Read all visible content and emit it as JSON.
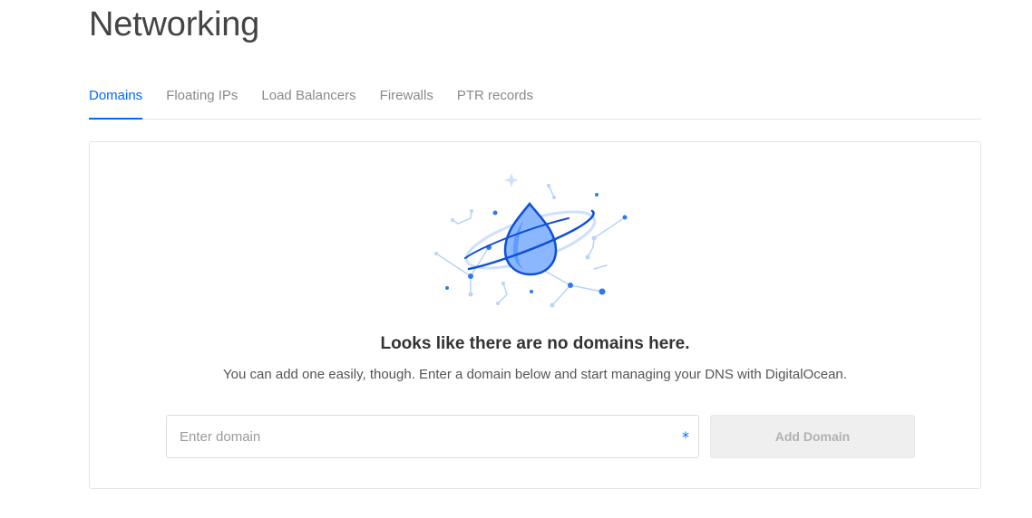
{
  "page": {
    "title": "Networking"
  },
  "tabs": [
    {
      "label": "Domains",
      "active": true
    },
    {
      "label": "Floating IPs",
      "active": false
    },
    {
      "label": "Load Balancers",
      "active": false
    },
    {
      "label": "Firewalls",
      "active": false
    },
    {
      "label": "PTR records",
      "active": false
    }
  ],
  "empty_state": {
    "illustration": "water-drop-planet-illustration",
    "title": "Looks like there are no domains here.",
    "text": "You can add one easily, though. Enter a domain below and start managing your DNS with DigitalOcean."
  },
  "domain_form": {
    "placeholder": "Enter domain",
    "value": "",
    "required_mark": "*",
    "button_label": "Add Domain",
    "button_disabled": true
  },
  "colors": {
    "accent": "#0069ff",
    "tab_inactive": "#8a8a8a",
    "border": "#e5e5e5",
    "button_disabled_bg": "#efefef",
    "button_disabled_text": "#b2b2b2"
  }
}
